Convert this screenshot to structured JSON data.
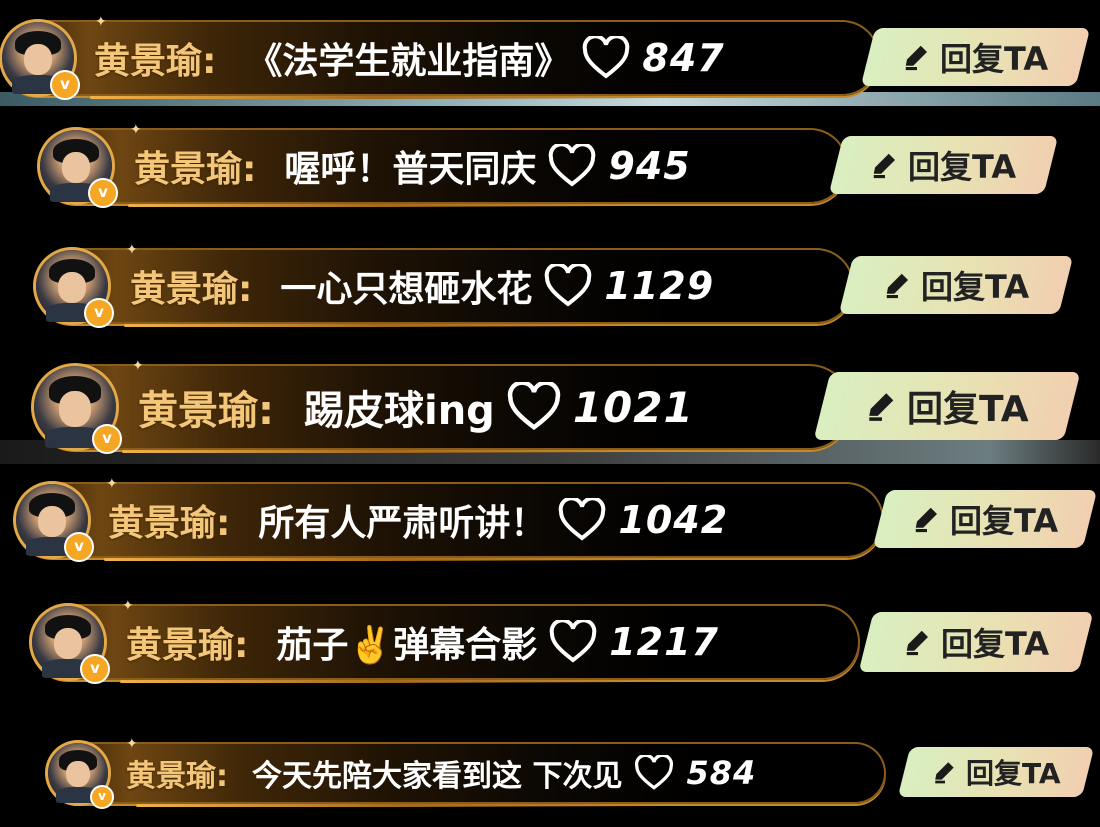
{
  "colors": {
    "username_gold": "#f3c67a",
    "message_white": "#ffffff",
    "reply_green": "#d9efc0",
    "reply_peach": "#f1cfb0",
    "badge_orange": "#f5a623"
  },
  "reply_icon": "pen-icon",
  "like_icon": "heart-outline-icon",
  "avatar_badge": "v",
  "comments": [
    {
      "username": "黄景瑜:",
      "message": "《法学生就业指南》",
      "likes": "847",
      "reply_label": "回复TA"
    },
    {
      "username": "黄景瑜:",
      "message": "喔呼！普天同庆",
      "likes": "945",
      "reply_label": "回复TA"
    },
    {
      "username": "黄景瑜:",
      "message": "一心只想砸水花",
      "likes": "1129",
      "reply_label": "回复TA"
    },
    {
      "username": "黄景瑜:",
      "message": "踢皮球ing",
      "likes": "1021",
      "reply_label": "回复TA"
    },
    {
      "username": "黄景瑜:",
      "message": "所有人严肃听讲！",
      "likes": "1042",
      "reply_label": "回复TA"
    },
    {
      "username": "黄景瑜:",
      "message": "茄子✌️弹幕合影",
      "likes": "1217",
      "reply_label": "回复TA"
    },
    {
      "username": "黄景瑜:",
      "message": "今天先陪大家看到这 下次见",
      "likes": "584",
      "reply_label": "回复TA"
    }
  ]
}
